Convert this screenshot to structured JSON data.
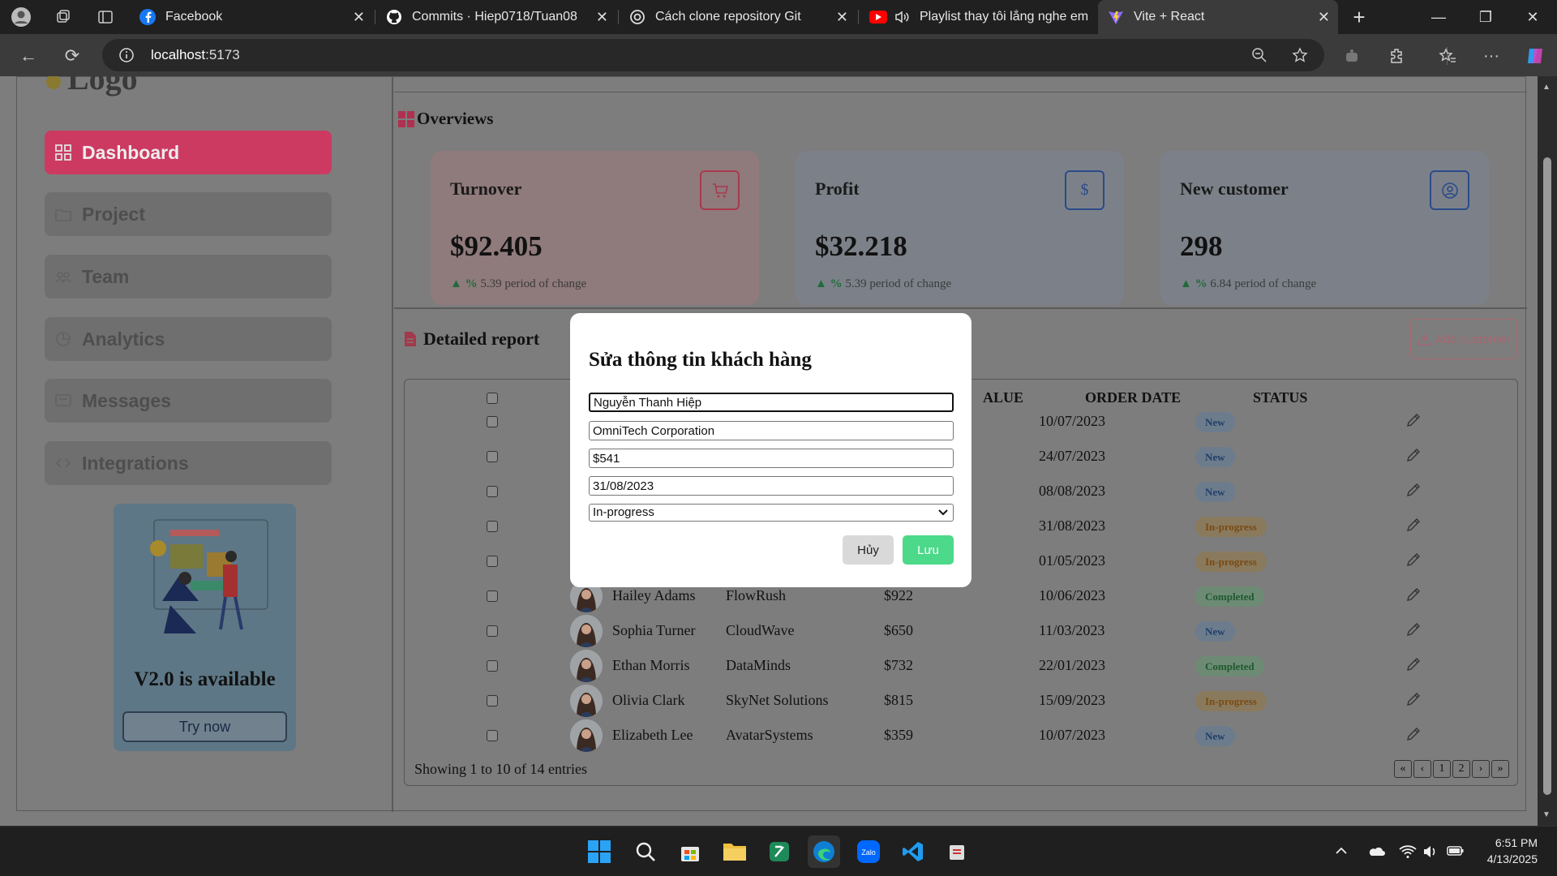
{
  "browser": {
    "tabs": [
      {
        "title": "Facebook",
        "icon": "facebook-icon"
      },
      {
        "title": "Commits · Hiep0718/Tuan08",
        "icon": "github-icon"
      },
      {
        "title": "Cách clone repository Git",
        "icon": "chatgpt-icon"
      },
      {
        "title": "Playlist thay tôi lắng nghe em",
        "icon": "youtube-icon"
      },
      {
        "title": "Vite + React",
        "icon": "vite-icon",
        "active": true
      }
    ],
    "url_host": "localhost",
    "url_port": ":5173"
  },
  "sidebar": {
    "logo": "Logo",
    "items": [
      {
        "label": "Dashboard",
        "icon": "dashboard-icon",
        "active": true
      },
      {
        "label": "Project",
        "icon": "folder-icon"
      },
      {
        "label": "Team",
        "icon": "team-icon"
      },
      {
        "label": "Analytics",
        "icon": "analytics-icon"
      },
      {
        "label": "Messages",
        "icon": "message-icon"
      },
      {
        "label": "Integrations",
        "icon": "code-icon"
      }
    ],
    "promo": {
      "title": "V2.0 is available",
      "button": "Try now"
    }
  },
  "overview": {
    "title": "Overviews",
    "cards": [
      {
        "title": "Turnover",
        "value": "$92.405",
        "pct": "%",
        "change": "5.39 period of change",
        "icon": "cart-icon",
        "color": "#f3d8dc"
      },
      {
        "title": "Profit",
        "value": "$32.218",
        "pct": "%",
        "change": "5.39 period of change",
        "icon": "dollar-icon",
        "color": "#e6ecf6"
      },
      {
        "title": "New customer",
        "value": "298",
        "pct": "%",
        "change": "6.84 period of change",
        "icon": "user-circle-icon",
        "color": "#e6ecf6"
      }
    ]
  },
  "report": {
    "title": "Detailed report",
    "add_button": "Add customer",
    "columns": [
      "ALUE",
      "ORDER DATE",
      "STATUS"
    ],
    "rows": [
      {
        "name": "",
        "company": "",
        "value": "",
        "date": "10/07/2023",
        "status": "New"
      },
      {
        "name": "",
        "company": "",
        "value": "",
        "date": "24/07/2023",
        "status": "New"
      },
      {
        "name": "",
        "company": "",
        "value": "",
        "date": "08/08/2023",
        "status": "New"
      },
      {
        "name": "",
        "company": "",
        "value": "",
        "date": "31/08/2023",
        "status": "In-progress"
      },
      {
        "name": "",
        "company": "",
        "value": "",
        "date": "01/05/2023",
        "status": "In-progress"
      },
      {
        "name": "Hailey Adams",
        "company": "FlowRush",
        "value": "$922",
        "date": "10/06/2023",
        "status": "Completed"
      },
      {
        "name": "Sophia Turner",
        "company": "CloudWave",
        "value": "$650",
        "date": "11/03/2023",
        "status": "New"
      },
      {
        "name": "Ethan Morris",
        "company": "DataMinds",
        "value": "$732",
        "date": "22/01/2023",
        "status": "Completed"
      },
      {
        "name": "Olivia Clark",
        "company": "SkyNet Solutions",
        "value": "$815",
        "date": "15/09/2023",
        "status": "In-progress"
      },
      {
        "name": "Elizabeth Lee",
        "company": "AvatarSystems",
        "value": "$359",
        "date": "10/07/2023",
        "status": "New"
      }
    ],
    "showing": "Showing 1 to 10 of 14 entries",
    "pager": [
      "«",
      "‹",
      "1",
      "2",
      "›",
      "»"
    ]
  },
  "modal": {
    "title": "Sửa thông tin khách hàng",
    "name": "Nguyễn Thanh Hiệp",
    "company": "OmniTech Corporation",
    "value": "$541",
    "date": "31/08/2023",
    "status": "In-progress",
    "cancel": "Hủy",
    "save": "Lưu"
  },
  "taskbar": {
    "time": "6:51 PM",
    "date": "4/13/2025"
  }
}
